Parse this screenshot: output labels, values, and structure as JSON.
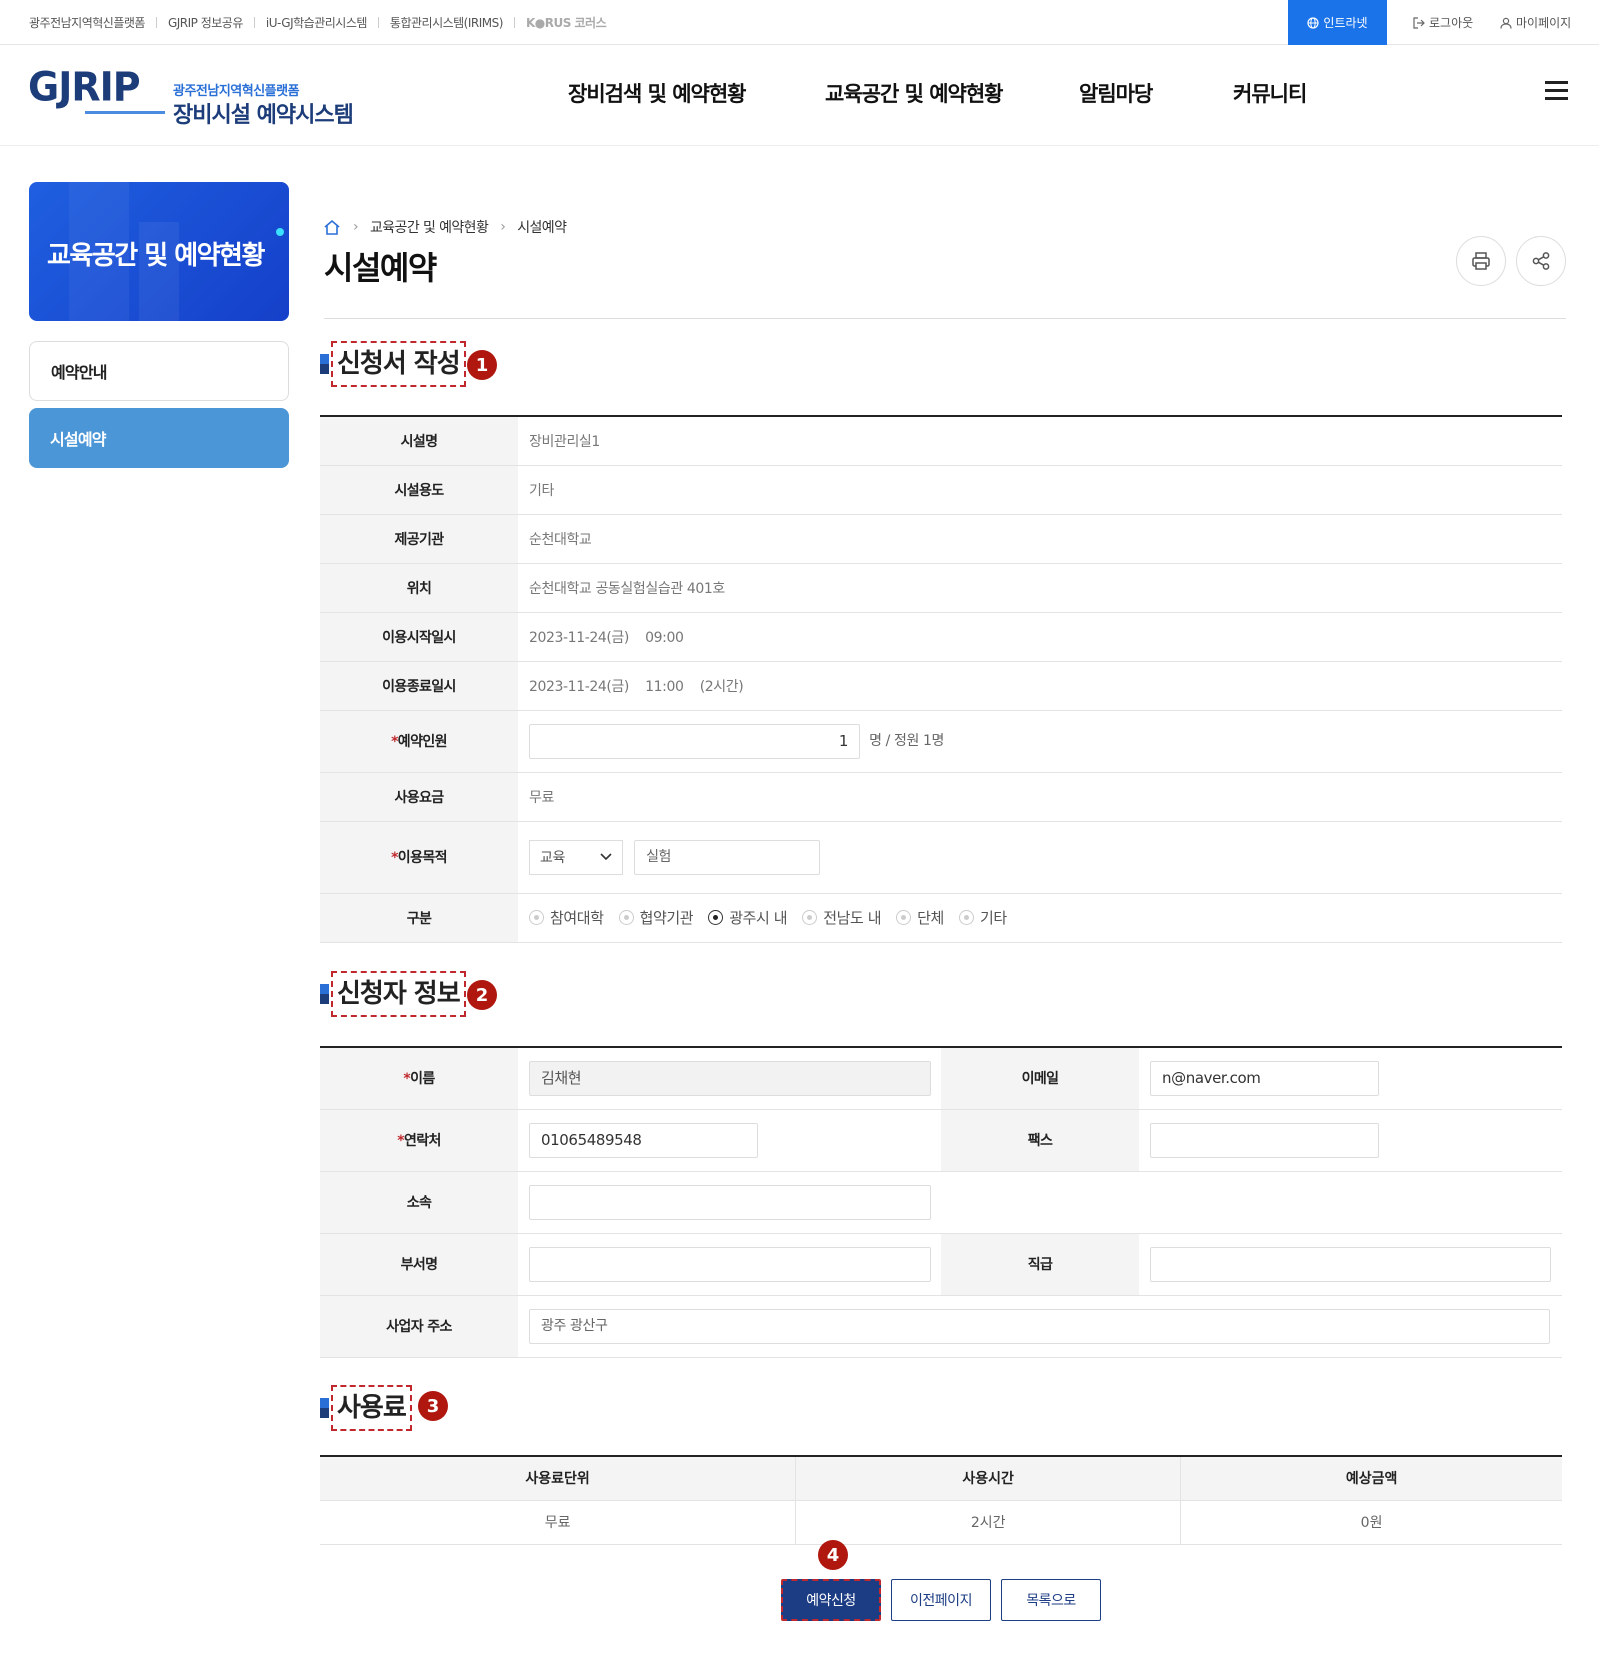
{
  "topbar": {
    "links": [
      "광주전남지역혁신플랫폼",
      "GJRIP 정보공유",
      "iU-GJ학습관리시스템",
      "통합관리시스템(IRIMS)",
      "K●RUS 코러스"
    ],
    "intranet": "인트라넷",
    "logout": "로그아웃",
    "mypage": "마이페이지"
  },
  "header": {
    "logo": "GJRIP",
    "logo_sub1": "광주전남지역혁신플랫폼",
    "logo_sub2": "장비시설 예약시스템",
    "nav": [
      "장비검색 및 예약현황",
      "교육공간 및 예약현황",
      "알림마당",
      "커뮤니티"
    ]
  },
  "sidebar": {
    "banner_title": "교육공간 및 예약현황",
    "items": [
      {
        "label": "예약안내",
        "active": false
      },
      {
        "label": "시설예약",
        "active": true
      }
    ]
  },
  "breadcrumb": [
    "교육공간 및 예약현황",
    "시설예약"
  ],
  "page_title": "시설예약",
  "sections": {
    "apply": {
      "title": "신청서 작성",
      "badge": "1"
    },
    "applicant": {
      "title": "신청자 정보",
      "badge": "2"
    },
    "fee": {
      "title": "사용료",
      "badge": "3"
    }
  },
  "form": {
    "facility_name_label": "시설명",
    "facility_name": "장비관리실1",
    "usage_label": "시설용도",
    "usage": "기타",
    "provider_label": "제공기관",
    "provider": "순천대학교",
    "location_label": "위치",
    "location": "순천대학교 공동실험실습관 401호",
    "start_label": "이용시작일시",
    "start_date": "2023-11-24(금)",
    "start_time": "09:00",
    "end_label": "이용종료일시",
    "end_date": "2023-11-24(금)",
    "end_time": "11:00",
    "end_duration": "(2시간)",
    "people_label": "예약인원",
    "people_value": "1",
    "people_suffix": "명 / 정원 1명",
    "fee_label": "사용요금",
    "fee": "무료",
    "purpose_label": "이용목적",
    "purpose_select": "교육",
    "purpose_text": "실험",
    "category_label": "구분",
    "categories": [
      {
        "label": "참여대학",
        "checked": false
      },
      {
        "label": "협약기관",
        "checked": false
      },
      {
        "label": "광주시 내",
        "checked": true
      },
      {
        "label": "전남도 내",
        "checked": false
      },
      {
        "label": "단체",
        "checked": false
      },
      {
        "label": "기타",
        "checked": false
      }
    ]
  },
  "applicant": {
    "name_label": "이름",
    "name": "김채현",
    "email_label": "이메일",
    "email": "n@naver.com",
    "phone_label": "연락처",
    "phone": "01065489548",
    "fax_label": "팩스",
    "fax": "",
    "affiliation_label": "소속",
    "affiliation": "",
    "dept_label": "부서명",
    "dept": "",
    "rank_label": "직급",
    "rank": "",
    "address_label": "사업자 주소",
    "address": "광주 광산구"
  },
  "fee_table": {
    "headers": [
      "사용료단위",
      "사용시간",
      "예상금액"
    ],
    "row": [
      "무료",
      "2시간",
      "0원"
    ]
  },
  "buttons": {
    "badge": "4",
    "submit": "예약신청",
    "prev": "이전페이지",
    "list": "목록으로"
  }
}
